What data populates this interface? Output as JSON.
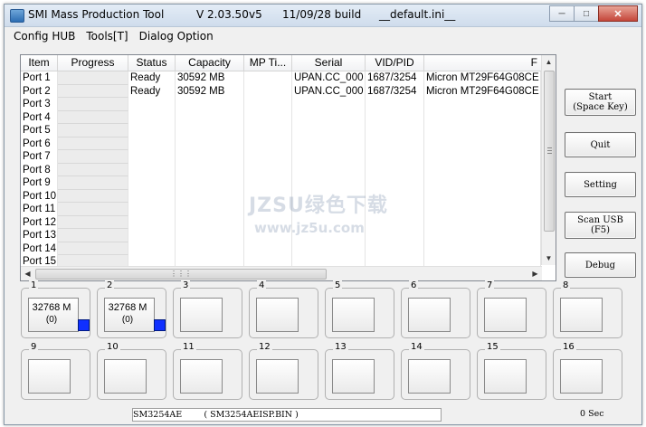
{
  "window": {
    "title_app": "SMI Mass Production Tool",
    "title_version": "V 2.03.50",
    "title_v": "v5",
    "title_build": "11/09/28 build",
    "title_ini": "__default.ini__"
  },
  "menu": {
    "items": [
      "Config HUB",
      "Tools[T]",
      "Dialog Option"
    ]
  },
  "grid": {
    "headers": [
      "Item",
      "Progress",
      "Status",
      "Capacity",
      "MP Ti...",
      "Serial",
      "VID/PID",
      "F"
    ],
    "rows": [
      [
        "Port 1",
        "",
        "Ready",
        "30592 MB",
        "",
        "UPAN.CC_000",
        "1687/3254",
        "Micron MT29F64G08CE"
      ],
      [
        "Port 2",
        "",
        "Ready",
        "30592 MB",
        "",
        "UPAN.CC_000",
        "1687/3254",
        "Micron MT29F64G08CE"
      ],
      [
        "Port 3",
        "",
        "",
        "",
        "",
        "",
        "",
        ""
      ],
      [
        "Port 4",
        "",
        "",
        "",
        "",
        "",
        "",
        ""
      ],
      [
        "Port 5",
        "",
        "",
        "",
        "",
        "",
        "",
        ""
      ],
      [
        "Port 6",
        "",
        "",
        "",
        "",
        "",
        "",
        ""
      ],
      [
        "Port 7",
        "",
        "",
        "",
        "",
        "",
        "",
        ""
      ],
      [
        "Port 8",
        "",
        "",
        "",
        "",
        "",
        "",
        ""
      ],
      [
        "Port 9",
        "",
        "",
        "",
        "",
        "",
        "",
        ""
      ],
      [
        "Port 10",
        "",
        "",
        "",
        "",
        "",
        "",
        ""
      ],
      [
        "Port 11",
        "",
        "",
        "",
        "",
        "",
        "",
        ""
      ],
      [
        "Port 12",
        "",
        "",
        "",
        "",
        "",
        "",
        ""
      ],
      [
        "Port 13",
        "",
        "",
        "",
        "",
        "",
        "",
        ""
      ],
      [
        "Port 14",
        "",
        "",
        "",
        "",
        "",
        "",
        ""
      ],
      [
        "Port 15",
        "",
        "",
        "",
        "",
        "",
        "",
        ""
      ]
    ]
  },
  "buttons": {
    "start_line1": "Start",
    "start_line2": "(Space Key)",
    "quit": "Quit",
    "setting": "Setting",
    "scan_line1": "Scan USB",
    "scan_line2": "(F5)",
    "debug": "Debug"
  },
  "ports": [
    {
      "num": "1",
      "capacity": "32768 M",
      "count": "(0)"
    },
    {
      "num": "2",
      "capacity": "32768 M",
      "count": "(0)"
    },
    {
      "num": "3"
    },
    {
      "num": "4"
    },
    {
      "num": "5"
    },
    {
      "num": "6"
    },
    {
      "num": "7"
    },
    {
      "num": "8"
    },
    {
      "num": "9"
    },
    {
      "num": "10"
    },
    {
      "num": "11"
    },
    {
      "num": "12"
    },
    {
      "num": "13"
    },
    {
      "num": "14"
    },
    {
      "num": "15"
    },
    {
      "num": "16"
    }
  ],
  "status": {
    "controller": "SM3254AE",
    "isp_file": "( SM3254AEISP.BIN )",
    "timer": "0 Sec"
  },
  "watermark": {
    "line1": "JZSU绿色下载",
    "line2": "www.jz5u.com"
  },
  "colors": {
    "led": "#1030ff",
    "progress_cell": "#ececec"
  }
}
